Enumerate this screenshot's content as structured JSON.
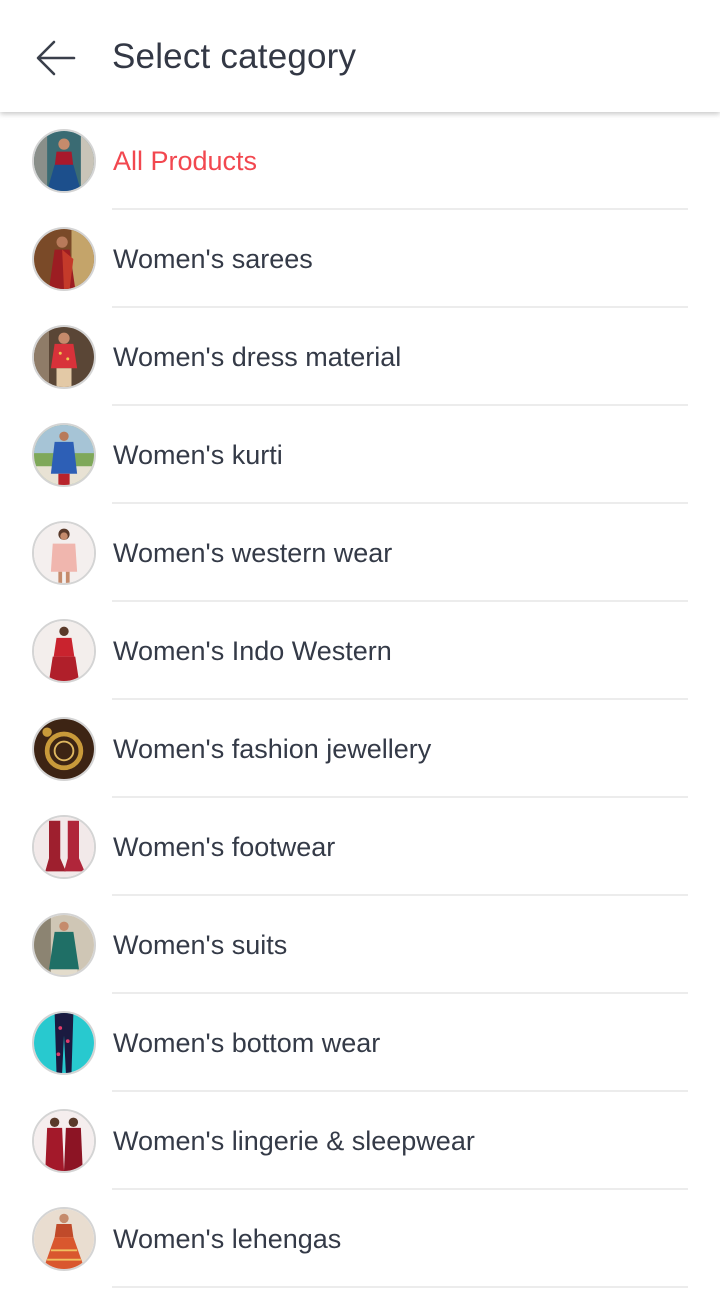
{
  "header": {
    "back_icon": "arrow-left-icon",
    "title": "Select category"
  },
  "colors": {
    "active_text": "#f2474f",
    "default_text": "#343a47",
    "divider": "#ececec"
  },
  "categories": [
    {
      "label": "All Products",
      "selected": true,
      "icon": "all-products-thumbnail"
    },
    {
      "label": "Women's sarees",
      "selected": false,
      "icon": "sarees-thumbnail"
    },
    {
      "label": "Women's dress material",
      "selected": false,
      "icon": "dress-material-thumbnail"
    },
    {
      "label": "Women's kurti",
      "selected": false,
      "icon": "kurti-thumbnail"
    },
    {
      "label": "Women's western wear",
      "selected": false,
      "icon": "western-wear-thumbnail"
    },
    {
      "label": "Women's Indo Western",
      "selected": false,
      "icon": "indo-western-thumbnail"
    },
    {
      "label": "Women's fashion jewellery",
      "selected": false,
      "icon": "jewellery-thumbnail"
    },
    {
      "label": "Women's footwear",
      "selected": false,
      "icon": "footwear-thumbnail"
    },
    {
      "label": "Women's suits",
      "selected": false,
      "icon": "suits-thumbnail"
    },
    {
      "label": "Women's bottom wear",
      "selected": false,
      "icon": "bottom-wear-thumbnail"
    },
    {
      "label": "Women's lingerie & sleepwear",
      "selected": false,
      "icon": "lingerie-thumbnail"
    },
    {
      "label": "Women's lehengas",
      "selected": false,
      "icon": "lehengas-thumbnail"
    }
  ]
}
